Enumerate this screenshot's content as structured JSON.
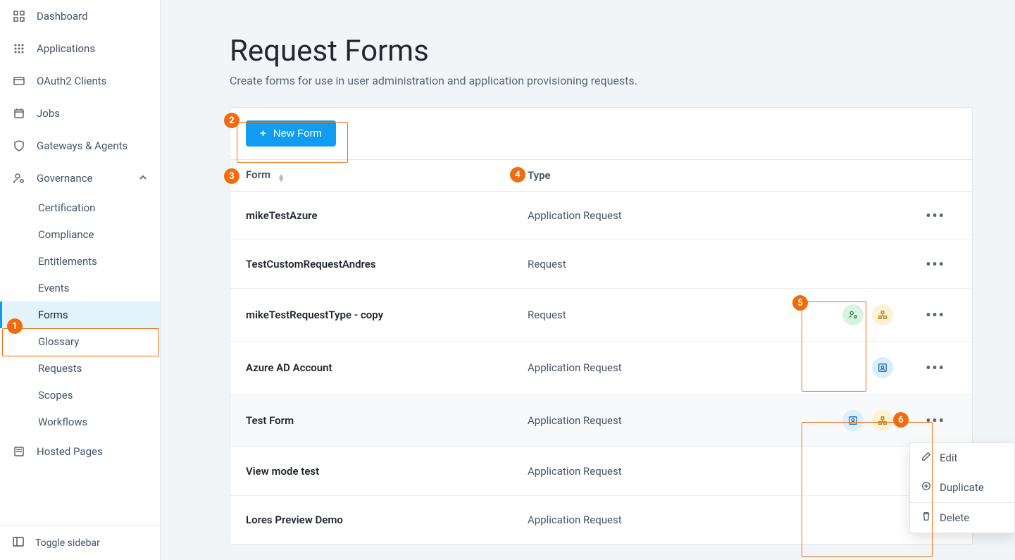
{
  "sidebar": {
    "items": [
      {
        "label": "Dashboard",
        "icon": "grid"
      },
      {
        "label": "Applications",
        "icon": "apps"
      },
      {
        "label": "OAuth2 Clients",
        "icon": "window"
      },
      {
        "label": "Jobs",
        "icon": "calendar"
      },
      {
        "label": "Gateways & Agents",
        "icon": "shield"
      },
      {
        "label": "Governance",
        "icon": "user-gear",
        "expanded": true
      }
    ],
    "governance_children": [
      {
        "label": "Certification"
      },
      {
        "label": "Compliance"
      },
      {
        "label": "Entitlements"
      },
      {
        "label": "Events"
      },
      {
        "label": "Forms",
        "active": true
      },
      {
        "label": "Glossary"
      },
      {
        "label": "Requests"
      },
      {
        "label": "Scopes"
      },
      {
        "label": "Workflows"
      }
    ],
    "hosted_pages": "Hosted Pages",
    "toggle": "Toggle sidebar"
  },
  "page": {
    "title": "Request Forms",
    "subtitle": "Create forms for use in user administration and application provisioning requests."
  },
  "toolbar": {
    "new_form": "New Form"
  },
  "table": {
    "headers": {
      "form": "Form",
      "type": "Type"
    },
    "rows": [
      {
        "name": "mikeTestAzure",
        "type": "Application Request",
        "badges": []
      },
      {
        "name": "TestCustomRequestAndres",
        "type": "Request",
        "badges": []
      },
      {
        "name": "mikeTestRequestType - copy",
        "type": "Request",
        "badges": [
          "green",
          "yellow"
        ]
      },
      {
        "name": "Azure AD Account",
        "type": "Application Request",
        "badges": [
          "blue"
        ]
      },
      {
        "name": "Test Form",
        "type": "Application Request",
        "badges": [
          "blue",
          "yellow"
        ],
        "hover": true
      },
      {
        "name": "View mode test",
        "type": "Application Request",
        "badges": []
      },
      {
        "name": "Lores Preview Demo",
        "type": "Application Request",
        "badges": []
      }
    ]
  },
  "menu": {
    "edit": "Edit",
    "duplicate": "Duplicate",
    "delete": "Delete"
  },
  "callouts": {
    "c1": "1",
    "c2": "2",
    "c3": "3",
    "c4": "4",
    "c5": "5",
    "c6": "6"
  }
}
